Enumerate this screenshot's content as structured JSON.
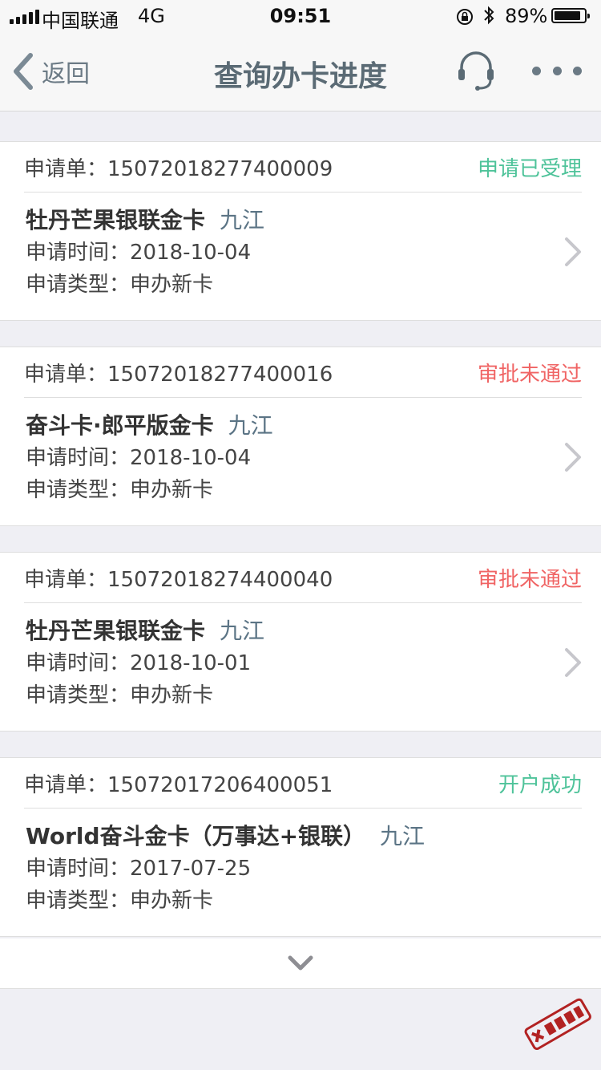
{
  "status_bar": {
    "carrier": "中国联通",
    "network": "4G",
    "time": "09:51",
    "battery_percent": "89%",
    "battery_level": 0.89
  },
  "nav": {
    "back_label": "返回",
    "title": "查询办卡进度",
    "service_icon": "headset-icon",
    "more_icon": "more-icon"
  },
  "labels": {
    "app_no_prefix": "申请单：",
    "apply_time_prefix": "申请时间：",
    "apply_type_prefix": "申请类型："
  },
  "colors": {
    "status_green": "#4fc39a",
    "status_red": "#f06464"
  },
  "applications": [
    {
      "app_no": "15072018277400009",
      "status": "申请已受理",
      "card_name": "牡丹芒果银联金卡",
      "city": "九江",
      "apply_time": "2018-10-04",
      "apply_type": "申办新卡"
    },
    {
      "app_no": "15072018277400016",
      "status": "审批未通过",
      "card_name": "奋斗卡·郎平版金卡",
      "city": "九江",
      "apply_time": "2018-10-04",
      "apply_type": "申办新卡"
    },
    {
      "app_no": "15072018274400040",
      "status": "审批未通过",
      "card_name": "牡丹芒果银联金卡",
      "city": "九江",
      "apply_time": "2018-10-01",
      "apply_type": "申办新卡"
    },
    {
      "app_no": "15072017206400051",
      "status": "开户成功",
      "card_name": "World奋斗金卡（万事达+银联）",
      "city": "九江",
      "apply_time": "2017-07-25",
      "apply_type": "申办新卡"
    }
  ],
  "watermark": {
    "text": "卡农社区"
  }
}
